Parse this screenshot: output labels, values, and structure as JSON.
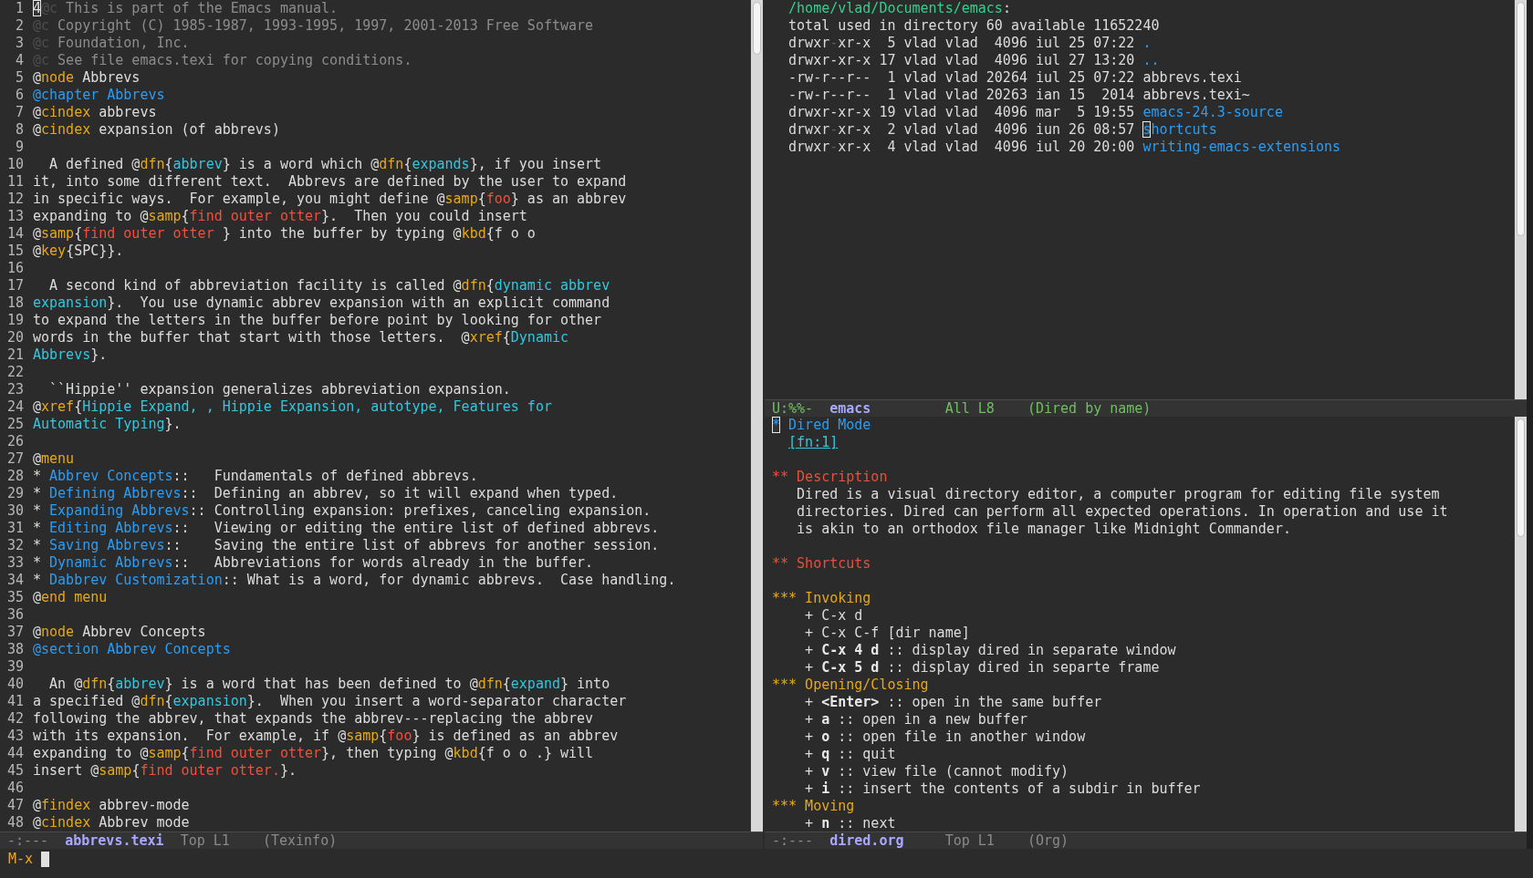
{
  "source_window": {
    "lines": [
      {
        "number": "1",
        "segments": [
          {
            "kind": "cursor",
            "text": "4"
          },
          {
            "kind": "comment-mark",
            "text": "@c"
          },
          {
            "kind": "comment",
            "text": " This is part of the Emacs manual."
          }
        ]
      },
      {
        "number": "2",
        "segments": [
          {
            "kind": "comment-mark",
            "text": "@c"
          },
          {
            "kind": "comment",
            "text": " Copyright (C) 1985-1987, 1993-1995, 1997, 2001-2013 Free Software"
          }
        ]
      },
      {
        "number": "3",
        "segments": [
          {
            "kind": "comment-mark",
            "text": "@c"
          },
          {
            "kind": "comment",
            "text": " Foundation, Inc."
          }
        ]
      },
      {
        "number": "4",
        "segments": [
          {
            "kind": "comment-mark",
            "text": "@c"
          },
          {
            "kind": "comment",
            "text": " See file emacs.texi for copying conditions."
          }
        ]
      },
      {
        "number": "5",
        "segments": [
          {
            "kind": "text",
            "text": "@"
          },
          {
            "kind": "keyword",
            "text": "node"
          },
          {
            "kind": "text",
            "text": " Abbrevs"
          }
        ]
      },
      {
        "number": "6",
        "segments": [
          {
            "kind": "heading",
            "text": "@chapter Abbrevs"
          }
        ]
      },
      {
        "number": "7",
        "segments": [
          {
            "kind": "text",
            "text": "@"
          },
          {
            "kind": "keyword",
            "text": "cindex"
          },
          {
            "kind": "text",
            "text": " abbrevs"
          }
        ]
      },
      {
        "number": "8",
        "segments": [
          {
            "kind": "text",
            "text": "@"
          },
          {
            "kind": "keyword",
            "text": "cindex"
          },
          {
            "kind": "text",
            "text": " expansion (of abbrevs)"
          }
        ]
      },
      {
        "number": "9"
      },
      {
        "number": "10",
        "segments": [
          {
            "kind": "text",
            "text": "  A defined @"
          },
          {
            "kind": "keyword",
            "text": "dfn"
          },
          {
            "kind": "text",
            "text": "{"
          },
          {
            "kind": "term",
            "text": "abbrev"
          },
          {
            "kind": "text",
            "text": "} is a word which @"
          },
          {
            "kind": "keyword",
            "text": "dfn"
          },
          {
            "kind": "text",
            "text": "{"
          },
          {
            "kind": "term",
            "text": "expands"
          },
          {
            "kind": "text",
            "text": "}, if you insert"
          }
        ]
      },
      {
        "number": "11",
        "segments": [
          {
            "kind": "text",
            "text": "it, into some different text.  Abbrevs are defined by the user to expand"
          }
        ]
      },
      {
        "number": "12",
        "segments": [
          {
            "kind": "text",
            "text": "in specific ways.  For example, you might define @"
          },
          {
            "kind": "keyword",
            "text": "samp"
          },
          {
            "kind": "text",
            "text": "{"
          },
          {
            "kind": "sample",
            "text": "foo"
          },
          {
            "kind": "text",
            "text": "} as an abbrev"
          }
        ]
      },
      {
        "number": "13",
        "segments": [
          {
            "kind": "text",
            "text": "expanding to @"
          },
          {
            "kind": "keyword",
            "text": "samp"
          },
          {
            "kind": "text",
            "text": "{"
          },
          {
            "kind": "sample",
            "text": "find outer otter"
          },
          {
            "kind": "text",
            "text": "}.  Then you could insert"
          }
        ]
      },
      {
        "number": "14",
        "segments": [
          {
            "kind": "text",
            "text": "@"
          },
          {
            "kind": "keyword",
            "text": "samp"
          },
          {
            "kind": "text",
            "text": "{"
          },
          {
            "kind": "sample",
            "text": "find outer otter "
          },
          {
            "kind": "text",
            "text": "} into the buffer by typing @"
          },
          {
            "kind": "keyword",
            "text": "kbd"
          },
          {
            "kind": "text",
            "text": "{f o o"
          }
        ]
      },
      {
        "number": "15",
        "segments": [
          {
            "kind": "text",
            "text": "@"
          },
          {
            "kind": "keyword",
            "text": "key"
          },
          {
            "kind": "text",
            "text": "{SPC}}."
          }
        ]
      },
      {
        "number": "16"
      },
      {
        "number": "17",
        "segments": [
          {
            "kind": "text",
            "text": "  A second kind of abbreviation facility is called @"
          },
          {
            "kind": "keyword",
            "text": "dfn"
          },
          {
            "kind": "text",
            "text": "{"
          },
          {
            "kind": "term",
            "text": "dynamic abbrev"
          }
        ]
      },
      {
        "number": "18",
        "segments": [
          {
            "kind": "term",
            "text": "expansion"
          },
          {
            "kind": "text",
            "text": "}.  You use dynamic abbrev expansion with an explicit command"
          }
        ]
      },
      {
        "number": "19",
        "segments": [
          {
            "kind": "text",
            "text": "to expand the letters in the buffer before point by looking for other"
          }
        ]
      },
      {
        "number": "20",
        "segments": [
          {
            "kind": "text",
            "text": "words in the buffer that start with those letters.  @"
          },
          {
            "kind": "keyword",
            "text": "xref"
          },
          {
            "kind": "text",
            "text": "{"
          },
          {
            "kind": "term",
            "text": "Dynamic"
          }
        ]
      },
      {
        "number": "21",
        "segments": [
          {
            "kind": "term",
            "text": "Abbrevs"
          },
          {
            "kind": "text",
            "text": "}."
          }
        ]
      },
      {
        "number": "22"
      },
      {
        "number": "23",
        "segments": [
          {
            "kind": "text",
            "text": "  ``Hippie'' expansion generalizes abbreviation expansion."
          }
        ]
      },
      {
        "number": "24",
        "segments": [
          {
            "kind": "text",
            "text": "@"
          },
          {
            "kind": "keyword",
            "text": "xref"
          },
          {
            "kind": "text",
            "text": "{"
          },
          {
            "kind": "term",
            "text": "Hippie Expand, , Hippie Expansion, autotype, Features for"
          }
        ]
      },
      {
        "number": "25",
        "segments": [
          {
            "kind": "term",
            "text": "Automatic Typing"
          },
          {
            "kind": "text",
            "text": "}."
          }
        ]
      },
      {
        "number": "26"
      },
      {
        "number": "27",
        "segments": [
          {
            "kind": "text",
            "text": "@"
          },
          {
            "kind": "keyword",
            "text": "menu"
          }
        ]
      },
      {
        "number": "28",
        "segments": [
          {
            "kind": "text",
            "text": "* "
          },
          {
            "kind": "link",
            "text": "Abbrev Concepts"
          },
          {
            "kind": "text",
            "text": "::   Fundamentals of defined abbrevs."
          }
        ]
      },
      {
        "number": "29",
        "segments": [
          {
            "kind": "text",
            "text": "* "
          },
          {
            "kind": "link",
            "text": "Defining Abbrevs"
          },
          {
            "kind": "text",
            "text": "::  Defining an abbrev, so it will expand when typed."
          }
        ]
      },
      {
        "number": "30",
        "segments": [
          {
            "kind": "text",
            "text": "* "
          },
          {
            "kind": "link",
            "text": "Expanding Abbrevs"
          },
          {
            "kind": "text",
            "text": ":: Controlling expansion: prefixes, canceling expansion."
          }
        ]
      },
      {
        "number": "31",
        "segments": [
          {
            "kind": "text",
            "text": "* "
          },
          {
            "kind": "link",
            "text": "Editing Abbrevs"
          },
          {
            "kind": "text",
            "text": "::   Viewing or editing the entire list of defined abbrevs."
          }
        ]
      },
      {
        "number": "32",
        "segments": [
          {
            "kind": "text",
            "text": "* "
          },
          {
            "kind": "link",
            "text": "Saving Abbrevs"
          },
          {
            "kind": "text",
            "text": "::    Saving the entire list of abbrevs for another session."
          }
        ]
      },
      {
        "number": "33",
        "segments": [
          {
            "kind": "text",
            "text": "* "
          },
          {
            "kind": "link",
            "text": "Dynamic Abbrevs"
          },
          {
            "kind": "text",
            "text": "::   Abbreviations for words already in the buffer."
          }
        ]
      },
      {
        "number": "34",
        "segments": [
          {
            "kind": "text",
            "text": "* "
          },
          {
            "kind": "link",
            "text": "Dabbrev Customization"
          },
          {
            "kind": "text",
            "text": ":: What is a word, for dynamic abbrevs.  Case handling."
          }
        ]
      },
      {
        "number": "35",
        "segments": [
          {
            "kind": "text",
            "text": "@"
          },
          {
            "kind": "keyword",
            "text": "end menu"
          }
        ]
      },
      {
        "number": "36"
      },
      {
        "number": "37",
        "segments": [
          {
            "kind": "text",
            "text": "@"
          },
          {
            "kind": "keyword",
            "text": "node"
          },
          {
            "kind": "text",
            "text": " Abbrev Concepts"
          }
        ]
      },
      {
        "number": "38",
        "segments": [
          {
            "kind": "heading",
            "text": "@section Abbrev Concepts"
          }
        ]
      },
      {
        "number": "39"
      },
      {
        "number": "40",
        "segments": [
          {
            "kind": "text",
            "text": "  An @"
          },
          {
            "kind": "keyword",
            "text": "dfn"
          },
          {
            "kind": "text",
            "text": "{"
          },
          {
            "kind": "term",
            "text": "abbrev"
          },
          {
            "kind": "text",
            "text": "} is a word that has been defined to @"
          },
          {
            "kind": "keyword",
            "text": "dfn"
          },
          {
            "kind": "text",
            "text": "{"
          },
          {
            "kind": "term",
            "text": "expand"
          },
          {
            "kind": "text",
            "text": "} into"
          }
        ]
      },
      {
        "number": "41",
        "segments": [
          {
            "kind": "text",
            "text": "a specified @"
          },
          {
            "kind": "keyword",
            "text": "dfn"
          },
          {
            "kind": "text",
            "text": "{"
          },
          {
            "kind": "term",
            "text": "expansion"
          },
          {
            "kind": "text",
            "text": "}.  When you insert a word-separator character"
          }
        ]
      },
      {
        "number": "42",
        "segments": [
          {
            "kind": "text",
            "text": "following the abbrev, that expands the abbrev---replacing the abbrev"
          }
        ]
      },
      {
        "number": "43",
        "segments": [
          {
            "kind": "text",
            "text": "with its expansion.  For example, if @"
          },
          {
            "kind": "keyword",
            "text": "samp"
          },
          {
            "kind": "text",
            "text": "{"
          },
          {
            "kind": "sample",
            "text": "foo"
          },
          {
            "kind": "text",
            "text": "} is defined as an abbrev"
          }
        ]
      },
      {
        "number": "44",
        "segments": [
          {
            "kind": "text",
            "text": "expanding to @"
          },
          {
            "kind": "keyword",
            "text": "samp"
          },
          {
            "kind": "text",
            "text": "{"
          },
          {
            "kind": "sample",
            "text": "find outer otter"
          },
          {
            "kind": "text",
            "text": "}, then typing @"
          },
          {
            "kind": "keyword",
            "text": "kbd"
          },
          {
            "kind": "text",
            "text": "{f o o .} will"
          }
        ]
      },
      {
        "number": "45",
        "segments": [
          {
            "kind": "text",
            "text": "insert @"
          },
          {
            "kind": "keyword",
            "text": "samp"
          },
          {
            "kind": "text",
            "text": "{"
          },
          {
            "kind": "sample",
            "text": "find outer otter."
          },
          {
            "kind": "text",
            "text": "}."
          }
        ]
      },
      {
        "number": "46"
      },
      {
        "number": "47",
        "segments": [
          {
            "kind": "text",
            "text": "@"
          },
          {
            "kind": "keyword",
            "text": "findex"
          },
          {
            "kind": "text",
            "text": " abbrev-mode"
          }
        ]
      },
      {
        "number": "48",
        "segments": [
          {
            "kind": "text",
            "text": "@"
          },
          {
            "kind": "keyword",
            "text": "cindex"
          },
          {
            "kind": "text",
            "text": " Abbrev mode"
          }
        ]
      }
    ],
    "mode_line": {
      "active": false,
      "status": "-:---",
      "buffer": "abbrevs.texi",
      "position": "Top L1",
      "mode": "(Texinfo)"
    }
  },
  "dired_window": {
    "lines": [
      {
        "segments": [
          {
            "kind": "path",
            "text": "  /home/vlad/Documents/emacs"
          },
          {
            "kind": "text",
            "text": ":"
          }
        ]
      },
      {
        "segments": [
          {
            "kind": "text",
            "text": "  total used in directory 60 available 11652240"
          }
        ]
      },
      {
        "segments": [
          {
            "kind": "text",
            "text": "  drwxr"
          },
          {
            "kind": "faint",
            "text": "-"
          },
          {
            "kind": "text",
            "text": "xr-x  5 vlad vlad  4096 iul 25 07:22 "
          },
          {
            "kind": "link",
            "text": "."
          }
        ]
      },
      {
        "segments": [
          {
            "kind": "text",
            "text": "  drwxr-xr-x 17 vlad vlad  4096 iul 27 13:20 "
          },
          {
            "kind": "link",
            "text": ".."
          }
        ]
      },
      {
        "segments": [
          {
            "kind": "text",
            "text": "  -rw-r--r--  1 vlad vlad 20264 iul 25 07:22 abbrevs.texi"
          }
        ]
      },
      {
        "segments": [
          {
            "kind": "text",
            "text": "  -rw-r--r--  1 vlad vlad 20263 ian 15  2014 abbrevs.texi~"
          }
        ]
      },
      {
        "segments": [
          {
            "kind": "text",
            "text": "  drwxr-xr-x 19 vlad vlad  4096 mar  5 19:55 "
          },
          {
            "kind": "link",
            "text": "emacs-24.3-source"
          }
        ]
      },
      {
        "segments": [
          {
            "kind": "text",
            "text": "  drwxr"
          },
          {
            "kind": "faint",
            "text": "-"
          },
          {
            "kind": "text",
            "text": "xr-x  2 vlad vlad  4096 iun 26 08:57 "
          },
          {
            "kind": "link-cursor",
            "text": "s"
          },
          {
            "kind": "link",
            "text": "hortcuts"
          }
        ]
      },
      {
        "segments": [
          {
            "kind": "text",
            "text": "  drwxr"
          },
          {
            "kind": "faint",
            "text": "-"
          },
          {
            "kind": "text",
            "text": "xr-x  4 vlad vlad  4096 iul 20 20:00 "
          },
          {
            "kind": "link",
            "text": "writing-emacs-extensions"
          }
        ]
      }
    ],
    "mode_line": {
      "active": true,
      "status": "U:%%-",
      "buffer": "emacs",
      "position": "All L8",
      "mode": "(Dired by name)"
    }
  },
  "org_window": {
    "blocks": [
      {
        "lines": [
          {
            "segments": [
              {
                "kind": "link-cursor",
                "text": "*"
              },
              {
                "kind": "link",
                "text": " Dired Mode"
              }
            ]
          },
          {
            "segments": [
              {
                "kind": "footnote",
                "text": "[fn:1]"
              }
            ]
          }
        ]
      },
      {
        "lines": [
          {
            "segments": [
              {
                "kind": "level2",
                "text": "** Description"
              }
            ]
          },
          {
            "segments": [
              {
                "kind": "text",
                "text": "   Dired is a visual directory editor, a computer program for editing file system"
              }
            ]
          },
          {
            "segments": [
              {
                "kind": "text",
                "text": "   directories. Dired can perform all expected operations. In operation and use it"
              }
            ]
          },
          {
            "segments": [
              {
                "kind": "text",
                "text": "   is akin to an orthodox file manager like Midnight Commander."
              }
            ]
          }
        ]
      },
      {
        "lines": [
          {
            "segments": [
              {
                "kind": "level2",
                "text": "** Shortcuts"
              }
            ]
          }
        ]
      },
      {
        "lines": [
          {
            "segments": [
              {
                "kind": "level3",
                "text": "*** Invoking"
              }
            ]
          },
          {
            "segments": [
              {
                "kind": "text",
                "text": "    + C-x d"
              }
            ]
          },
          {
            "segments": [
              {
                "kind": "text",
                "text": "    + C-x C-f [dir name]"
              }
            ]
          },
          {
            "segments": [
              {
                "kind": "text",
                "text": "    + "
              },
              {
                "kind": "bold",
                "text": "C-x 4 d"
              },
              {
                "kind": "text",
                "text": " :: display dired in separate window"
              }
            ]
          },
          {
            "segments": [
              {
                "kind": "text",
                "text": "    + "
              },
              {
                "kind": "bold",
                "text": "C-x 5 d"
              },
              {
                "kind": "text",
                "text": " :: display dired in separte frame"
              }
            ]
          },
          {
            "segments": [
              {
                "kind": "level3",
                "text": "*** Opening/Closing"
              }
            ]
          },
          {
            "segments": [
              {
                "kind": "text",
                "text": "    + "
              },
              {
                "kind": "bold",
                "text": "<Enter>"
              },
              {
                "kind": "text",
                "text": " :: open in the same buffer"
              }
            ]
          },
          {
            "segments": [
              {
                "kind": "text",
                "text": "    + "
              },
              {
                "kind": "bold",
                "text": "a"
              },
              {
                "kind": "text",
                "text": " :: open in a new buffer"
              }
            ]
          },
          {
            "segments": [
              {
                "kind": "text",
                "text": "    + "
              },
              {
                "kind": "bold",
                "text": "o"
              },
              {
                "kind": "text",
                "text": " :: open file in another window"
              }
            ]
          },
          {
            "segments": [
              {
                "kind": "text",
                "text": "    + "
              },
              {
                "kind": "bold",
                "text": "q"
              },
              {
                "kind": "text",
                "text": " :: quit"
              }
            ]
          },
          {
            "segments": [
              {
                "kind": "text",
                "text": "    + "
              },
              {
                "kind": "bold",
                "text": "v"
              },
              {
                "kind": "text",
                "text": " :: view file (cannot modify)"
              }
            ]
          },
          {
            "segments": [
              {
                "kind": "text",
                "text": "    + "
              },
              {
                "kind": "bold",
                "text": "i"
              },
              {
                "kind": "text",
                "text": " :: insert the contents of a subdir in buffer"
              }
            ]
          },
          {
            "segments": [
              {
                "kind": "level3",
                "text": "*** Moving"
              }
            ]
          },
          {
            "segments": [
              {
                "kind": "text",
                "text": "    + "
              },
              {
                "kind": "bold",
                "text": "n"
              },
              {
                "kind": "text",
                "text": " :: next"
              }
            ]
          }
        ]
      }
    ],
    "mode_line": {
      "active": false,
      "status": "-:---",
      "buffer": "dired.org",
      "position": "Top L1",
      "mode": "(Org)"
    }
  },
  "minibuffer": {
    "prompt": "M-x"
  }
}
